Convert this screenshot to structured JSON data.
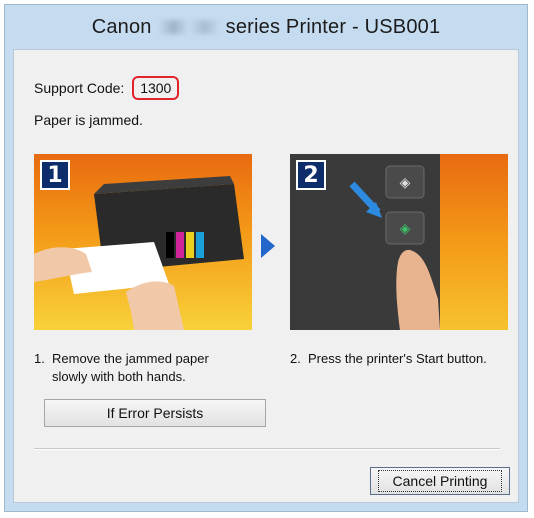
{
  "window": {
    "title_prefix": "Canon",
    "title_suffix": "series Printer - USB001"
  },
  "dialog": {
    "support_label": "Support Code:",
    "support_code": "1300",
    "message": "Paper is jammed.",
    "steps": [
      {
        "number": "1",
        "num_label": "1.",
        "text": "Remove the jammed paper slowly with both hands."
      },
      {
        "number": "2",
        "num_label": "2.",
        "text": "Press the printer's Start button."
      }
    ],
    "error_persists_label": "If Error Persists",
    "cancel_label": "Cancel Printing"
  },
  "colors": {
    "highlight": "#e0262b",
    "accent_arrow": "#2266cc",
    "step_badge": "#0e2d6b"
  }
}
